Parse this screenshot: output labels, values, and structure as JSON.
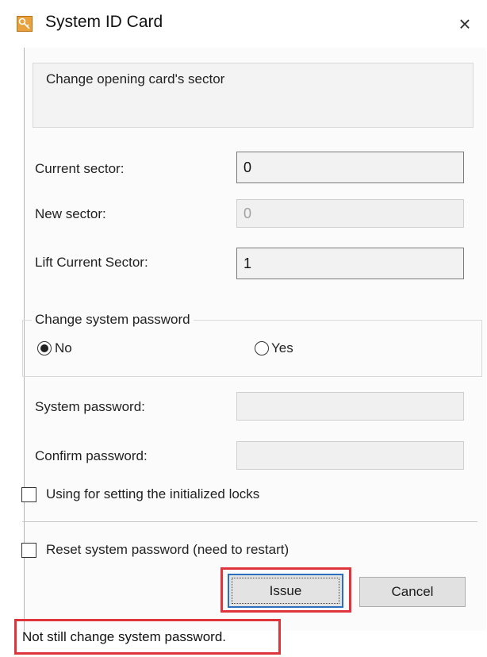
{
  "window": {
    "title": "System ID Card",
    "close_glyph": "×",
    "icon": "key-icon"
  },
  "sector_group": {
    "title": "Change opening card's sector",
    "current_sector_label": "Current sector:",
    "current_sector_value": "0",
    "new_sector_label": "New sector:",
    "new_sector_value": "0",
    "lift_sector_label": "Lift Current Sector:",
    "lift_sector_value": "1"
  },
  "password_group": {
    "title": "Change system password",
    "option_no": "No",
    "option_yes": "Yes",
    "selected": "No",
    "system_password_label": "System password:",
    "system_password_value": "",
    "confirm_password_label": "Confirm password:",
    "confirm_password_value": ""
  },
  "options": {
    "init_locks_label": "Using for setting the initialized locks",
    "init_locks_checked": false,
    "reset_password_label": "Reset system password (need to restart)",
    "reset_password_checked": false
  },
  "buttons": {
    "issue_label": "Issue",
    "cancel_label": "Cancel"
  },
  "status": {
    "message": "Not still change system password."
  },
  "colors": {
    "highlight": "#e0343d",
    "focus_border": "#2c6fbf"
  }
}
